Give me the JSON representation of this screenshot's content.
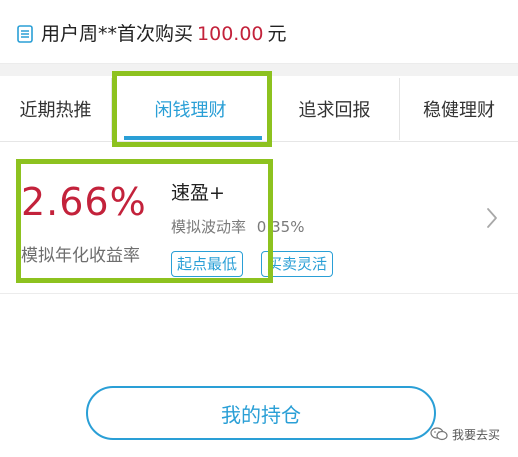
{
  "notice": {
    "prefix": "用户周**首次购买",
    "amount": "100.00",
    "suffix": "元",
    "icon": "list-icon"
  },
  "tabs": [
    {
      "label": "近期热推",
      "active": false
    },
    {
      "label": "闲钱理财",
      "active": true
    },
    {
      "label": "追求回报",
      "active": false
    },
    {
      "label": "稳健理财",
      "active": false
    }
  ],
  "product": {
    "rate": "2.66%",
    "rate_label": "模拟年化收益率",
    "name": "速盈+",
    "volatility_label": "模拟波动率",
    "volatility_value": "0.35%",
    "tags": [
      "起点最低",
      "买卖灵活"
    ],
    "chevron_icon": "chevron-right-icon"
  },
  "holdings_button": "我的持仓",
  "watermark": {
    "text": "我要去买",
    "icon": "wechat-icon"
  },
  "colors": {
    "accent": "#2a9fd6",
    "rate_red": "#c3223b",
    "highlight_green": "#8dc21f"
  }
}
